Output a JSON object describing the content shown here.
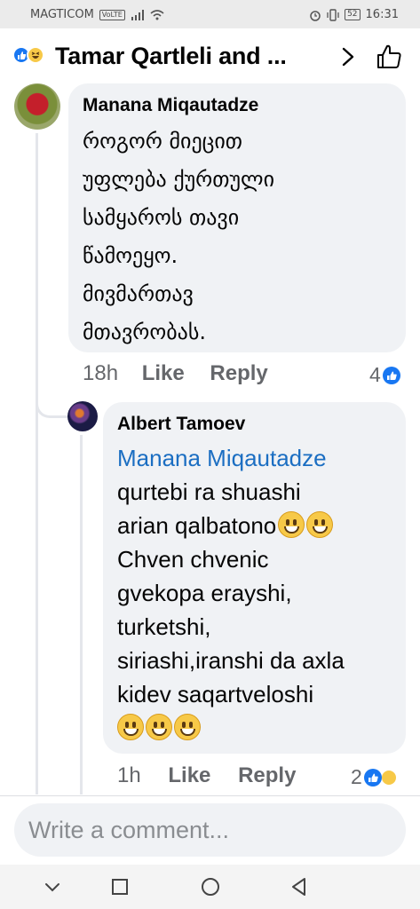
{
  "status_bar": {
    "carrier": "MAGTICOM",
    "network_badge": "VoLTE",
    "battery": "52",
    "time": "16:31",
    "icons": [
      "signal-icon",
      "wifi-icon",
      "alarm-icon",
      "vibrate-icon",
      "battery-icon"
    ]
  },
  "header": {
    "title": "Tamar Qartleli and ...",
    "reaction_icons": [
      "like-reaction-icon",
      "haha-reaction-icon"
    ],
    "chevron_icon": "chevron-right-icon",
    "like_icon": "thumbs-up-icon"
  },
  "comments": [
    {
      "author": "Manana Miqautadze",
      "lines": [
        "როგორ მიეცით",
        "უფლება ქურთული",
        "სამყაროს თავი",
        "წამოეყო.",
        "მივმართავ",
        "მთავრობას."
      ],
      "time": "18h",
      "like_label": "Like",
      "reply_label": "Reply",
      "reaction_count": "4"
    },
    {
      "author": "Albert Tamoev",
      "mention": "Manana Miqautadze",
      "lines": [
        "qurtebi ra shuashi",
        "arian qalbatono",
        "Chven chvenic",
        "gvekopa erayshi,",
        "turketshi,",
        "siriashi,iranshi da axla",
        "kidev saqartveloshi"
      ],
      "time": "1h",
      "like_label": "Like",
      "reply_label": "Reply",
      "reaction_count": "2"
    }
  ],
  "composer": {
    "placeholder": "Write a comment..."
  },
  "nav": {
    "icons": [
      "collapse-icon",
      "recents-icon",
      "home-icon",
      "back-icon"
    ]
  },
  "colors": {
    "accent": "#1877f2",
    "bubble": "#f0f2f5",
    "muted": "#65676b",
    "mention": "#1b6ec2"
  }
}
